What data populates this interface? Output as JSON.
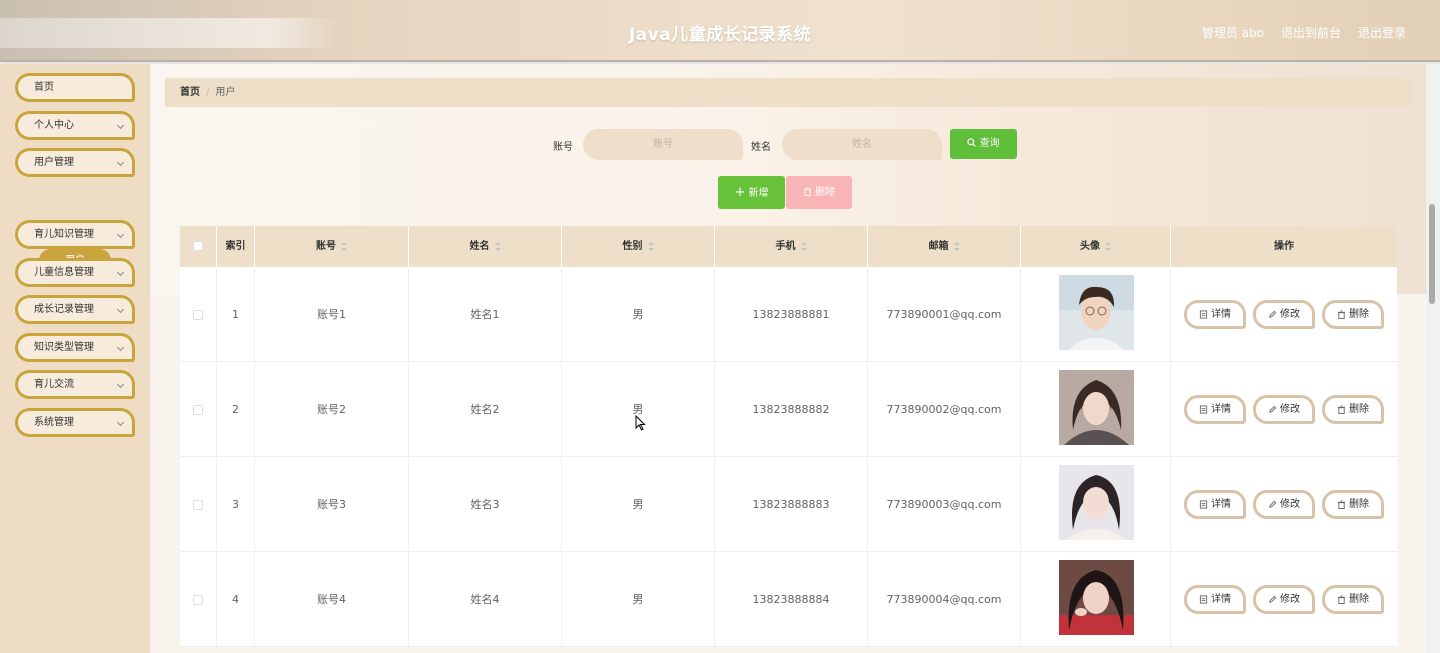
{
  "header": {
    "title": "Java儿童成长记录系统",
    "user_label": "管理员 abo",
    "front_link": "退出到前台",
    "logout_link": "退出登录"
  },
  "sidebar": {
    "items": [
      {
        "label": "首页",
        "has_arrow": false
      },
      {
        "label": "个人中心",
        "has_arrow": true
      },
      {
        "label": "用户管理",
        "has_arrow": true
      },
      {
        "label": "育儿知识管理",
        "has_arrow": true
      },
      {
        "label": "儿童信息管理",
        "has_arrow": true
      },
      {
        "label": "成长记录管理",
        "has_arrow": true
      },
      {
        "label": "知识类型管理",
        "has_arrow": true
      },
      {
        "label": "育儿交流",
        "has_arrow": true
      },
      {
        "label": "系统管理",
        "has_arrow": true
      }
    ],
    "sub_item": "用户"
  },
  "breadcrumb": {
    "home": "首页",
    "sep": "/",
    "current": "用户"
  },
  "search": {
    "account_label": "账号",
    "account_placeholder": "账号",
    "name_label": "姓名",
    "name_placeholder": "姓名",
    "search_button": "查询"
  },
  "actions": {
    "add": "新增",
    "delete": "删除"
  },
  "table": {
    "headers": [
      "索引",
      "账号",
      "姓名",
      "性别",
      "手机",
      "邮箱",
      "头像",
      "操作"
    ],
    "rows": [
      {
        "index": "1",
        "account": "账号1",
        "name": "姓名1",
        "gender": "男",
        "phone": "13823888881",
        "email": "773890001@qq.com"
      },
      {
        "index": "2",
        "account": "账号2",
        "name": "姓名2",
        "gender": "男",
        "phone": "13823888882",
        "email": "773890002@qq.com"
      },
      {
        "index": "3",
        "account": "账号3",
        "name": "姓名3",
        "gender": "男",
        "phone": "13823888883",
        "email": "773890003@qq.com"
      },
      {
        "index": "4",
        "account": "账号4",
        "name": "姓名4",
        "gender": "男",
        "phone": "13823888884",
        "email": "773890004@qq.com"
      }
    ],
    "row_actions": {
      "detail": "详情",
      "edit": "修改",
      "delete": "删除"
    }
  },
  "colors": {
    "accent_gold": "#c9a43c",
    "sidebar_bg": "#efdcc4",
    "search_green": "#5fbf3a",
    "delete_pink": "#f9b5b5"
  }
}
